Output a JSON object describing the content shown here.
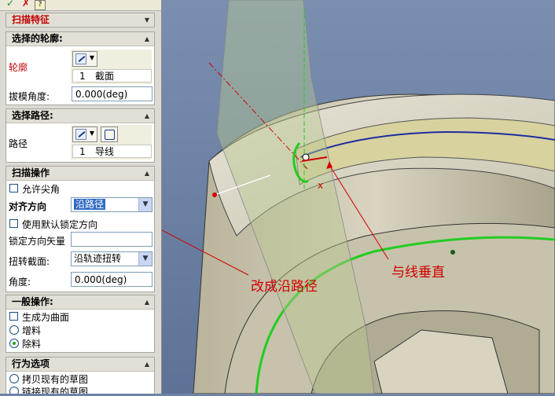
{
  "toolbar": {
    "ok_icon": "✓",
    "cancel_icon": "✗",
    "help_icon": "?"
  },
  "sweep_feature": {
    "title": "扫描特征"
  },
  "profile_section": {
    "title": "选择的轮廓:",
    "profile_label": "轮廓",
    "list": [
      {
        "index": "1",
        "name": "截面"
      }
    ],
    "draft_angle_label": "拔模角度:",
    "draft_angle_value": "0.000(deg)"
  },
  "path_section": {
    "title": "选择路径:",
    "path_label": "路径",
    "list": [
      {
        "index": "1",
        "name": "导线"
      }
    ]
  },
  "sweep_ops": {
    "title": "扫描操作",
    "allow_sharp_corner": "允许尖角",
    "align_direction_label": "对齐方向",
    "align_direction_value": "沿路径",
    "use_default_lock_dir": "使用默认锁定方向",
    "lock_dir_vector_label": "锁定方向矢量",
    "lock_dir_vector_value": "",
    "twist_section_label": "扭转截面:",
    "twist_section_value": "沿轨迹扭转",
    "angle_label": "角度:",
    "angle_value": "0.000(deg)"
  },
  "general_ops": {
    "title": "一般操作:",
    "generate_surface": "生成为曲面",
    "add_material": "增料",
    "remove_material": "除料",
    "selected": "remove_material"
  },
  "behavior": {
    "title": "行为选项",
    "copy_sketch": "拷贝现有的草图",
    "link_sketch": "链接现有的草图"
  },
  "viewport": {
    "annotation_change_to_path": "改成沿路径",
    "annotation_perpendicular": "与线垂直",
    "axis_label": "x"
  },
  "colors": {
    "annotation": "#d10000",
    "path_curve": "#22cc22",
    "highlight": "#316ac5"
  }
}
